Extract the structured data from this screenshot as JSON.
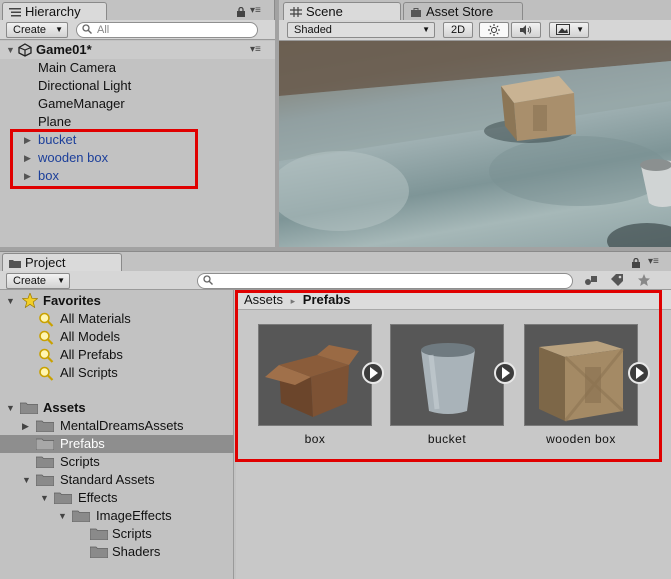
{
  "hierarchy": {
    "tab_label": "Hierarchy",
    "create_label": "Create",
    "search_placeholder": "All",
    "scene_name": "Game01*",
    "items": [
      {
        "label": "Main Camera"
      },
      {
        "label": "Directional Light"
      },
      {
        "label": "GameManager"
      },
      {
        "label": "Plane"
      },
      {
        "label": "bucket"
      },
      {
        "label": "wooden box"
      },
      {
        "label": "box"
      }
    ]
  },
  "scene": {
    "tab_label": "Scene",
    "asset_store_tab_label": "Asset Store",
    "shading_mode": "Shaded",
    "mode_2d_label": "2D"
  },
  "project": {
    "tab_label": "Project",
    "create_label": "Create",
    "favorites": {
      "label": "Favorites",
      "items": [
        {
          "label": "All Materials"
        },
        {
          "label": "All Models"
        },
        {
          "label": "All Prefabs"
        },
        {
          "label": "All Scripts"
        }
      ]
    },
    "assets": {
      "label": "Assets",
      "folders": {
        "mental": "MentalDreamsAssets",
        "prefabs": "Prefabs",
        "scripts": "Scripts",
        "standard": "Standard Assets",
        "effects": "Effects",
        "image_effects": "ImageEffects",
        "ie_scripts": "Scripts",
        "ie_shaders": "Shaders"
      }
    },
    "breadcrumb": {
      "root": "Assets",
      "separator": "▸",
      "current": "Prefabs"
    },
    "prefabs": [
      {
        "label": "box"
      },
      {
        "label": "bucket"
      },
      {
        "label": "wooden box"
      }
    ]
  },
  "colors": {
    "highlight": "#e00000",
    "prefab_text": "#1c3f9a",
    "selected_row": "#8e8e8e"
  }
}
